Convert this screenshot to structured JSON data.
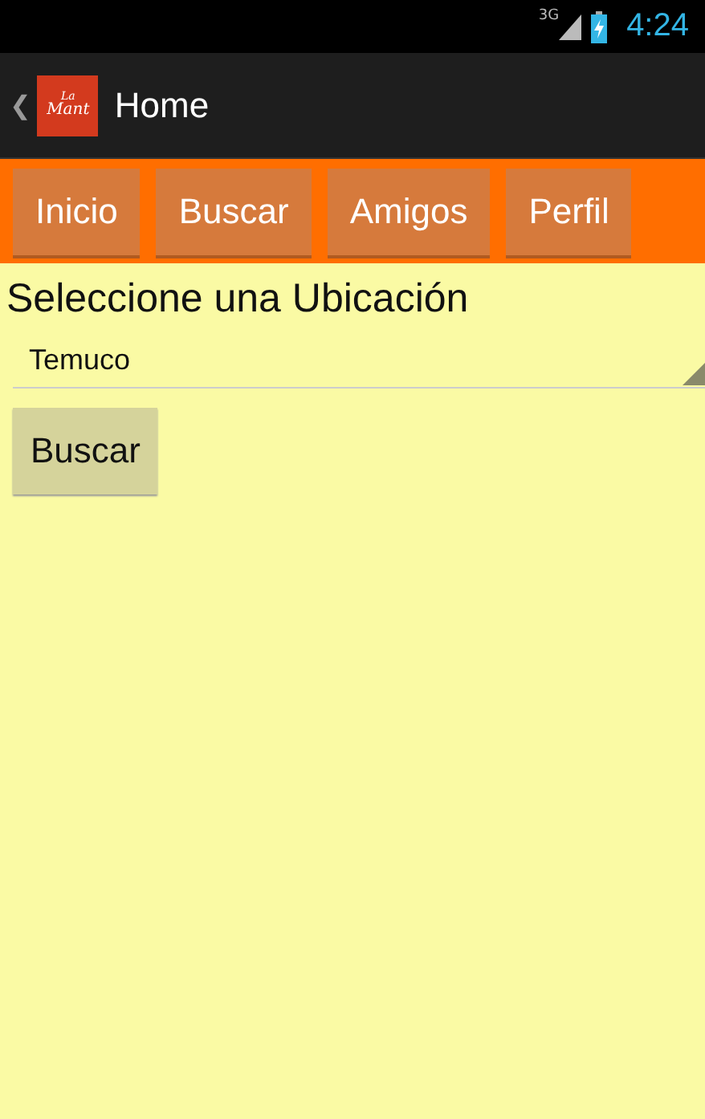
{
  "status_bar": {
    "network": "3G",
    "time": "4:24"
  },
  "action_bar": {
    "back": "❮",
    "logo": [
      "La",
      "Mant"
    ],
    "title": "Home"
  },
  "nav_buttons": [
    "Inicio",
    "Buscar",
    "Amigos",
    "Perfil"
  ],
  "content": {
    "heading": "Seleccione una Ubicación",
    "location_select": {
      "value": "Temuco"
    },
    "search_button": "Buscar"
  }
}
